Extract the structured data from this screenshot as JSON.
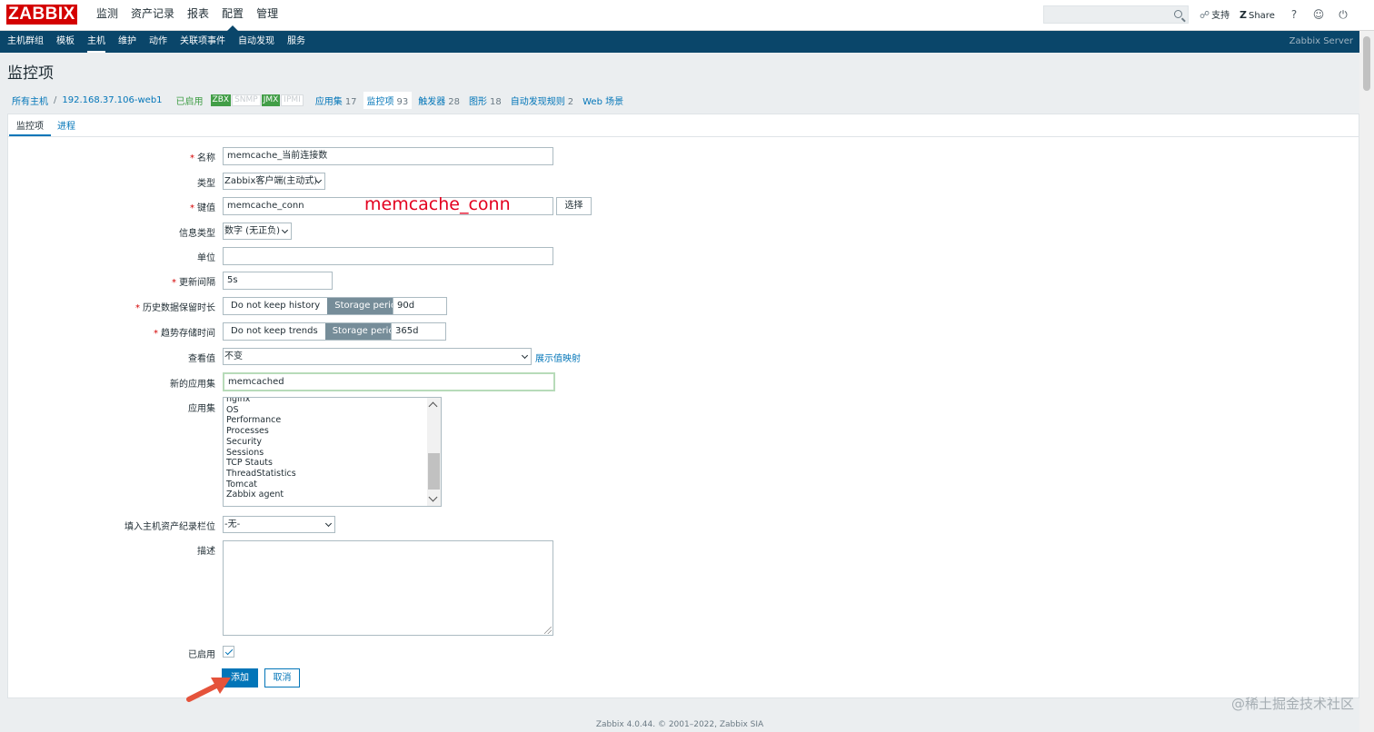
{
  "header": {
    "logo": "ZABBIX",
    "menu": [
      "监测",
      "资产记录",
      "报表",
      "配置",
      "管理"
    ],
    "active_menu": 3,
    "support": "支持",
    "share": "Share",
    "help_glyph": "?",
    "user_glyph": "☺",
    "power_glyph": "⏻"
  },
  "submenu": {
    "items": [
      "主机群组",
      "模板",
      "主机",
      "维护",
      "动作",
      "关联项事件",
      "自动发现",
      "服务"
    ],
    "active": 2,
    "server": "Zabbix Server"
  },
  "page": {
    "title": "监控项"
  },
  "breadcrumb": {
    "all_hosts": "所有主机",
    "sep": "/",
    "host": "192.168.37.106-web1",
    "status": "已启用",
    "badges": [
      {
        "label": "ZBX",
        "on": true
      },
      {
        "label": "SNMP",
        "on": false
      },
      {
        "label": "JMX",
        "on": true
      },
      {
        "label": "IPMI",
        "on": false
      }
    ],
    "apps": {
      "label": "应用集",
      "count": "17"
    },
    "items": {
      "label": "监控项",
      "count": "93"
    },
    "triggers": {
      "label": "触发器",
      "count": "28"
    },
    "graphs": {
      "label": "图形",
      "count": "18"
    },
    "discovery": {
      "label": "自动发现规则",
      "count": "2"
    },
    "web": {
      "label": "Web 场景"
    }
  },
  "tabs": [
    "监控项",
    "进程"
  ],
  "form": {
    "name": {
      "label": "名称",
      "value": "memcache_当前连接数"
    },
    "type": {
      "label": "类型",
      "value": "Zabbix客户端(主动式)"
    },
    "key": {
      "label": "键值",
      "value": "memcache_conn",
      "select_btn": "选择"
    },
    "annotation": "memcache_conn",
    "info_type": {
      "label": "信息类型",
      "value": "数字 (无正负)"
    },
    "units": {
      "label": "单位",
      "value": ""
    },
    "interval": {
      "label": "更新间隔",
      "value": "5s"
    },
    "history": {
      "label": "历史数据保留时长",
      "opt1": "Do not keep history",
      "opt2": "Storage period",
      "value": "90d"
    },
    "trends": {
      "label": "趋势存储时间",
      "opt1": "Do not keep trends",
      "opt2": "Storage period",
      "value": "365d"
    },
    "show_value": {
      "label": "查看值",
      "value": "不变",
      "link": "展示值映射"
    },
    "new_app": {
      "label": "新的应用集",
      "value": "memcached"
    },
    "apps": {
      "label": "应用集",
      "options": [
        "nginx",
        "OS",
        "Performance",
        "Processes",
        "Security",
        "Sessions",
        "TCP Stauts",
        "ThreadStatistics",
        "Tomcat",
        "Zabbix agent"
      ]
    },
    "inventory": {
      "label": "填入主机资产纪录栏位",
      "value": "-无-"
    },
    "description": {
      "label": "描述"
    },
    "enabled": {
      "label": "已启用",
      "checked": true
    },
    "add_btn": "添加",
    "cancel_btn": "取消"
  },
  "footer": "Zabbix 4.0.44. © 2001–2022, Zabbix SIA",
  "watermark": "@稀土掘金技术社区",
  "colors": {
    "brand": "#d40000",
    "nav": "#0a466a",
    "link": "#0275b8",
    "enabled": "#429e47",
    "annotation": "#e3001f"
  }
}
